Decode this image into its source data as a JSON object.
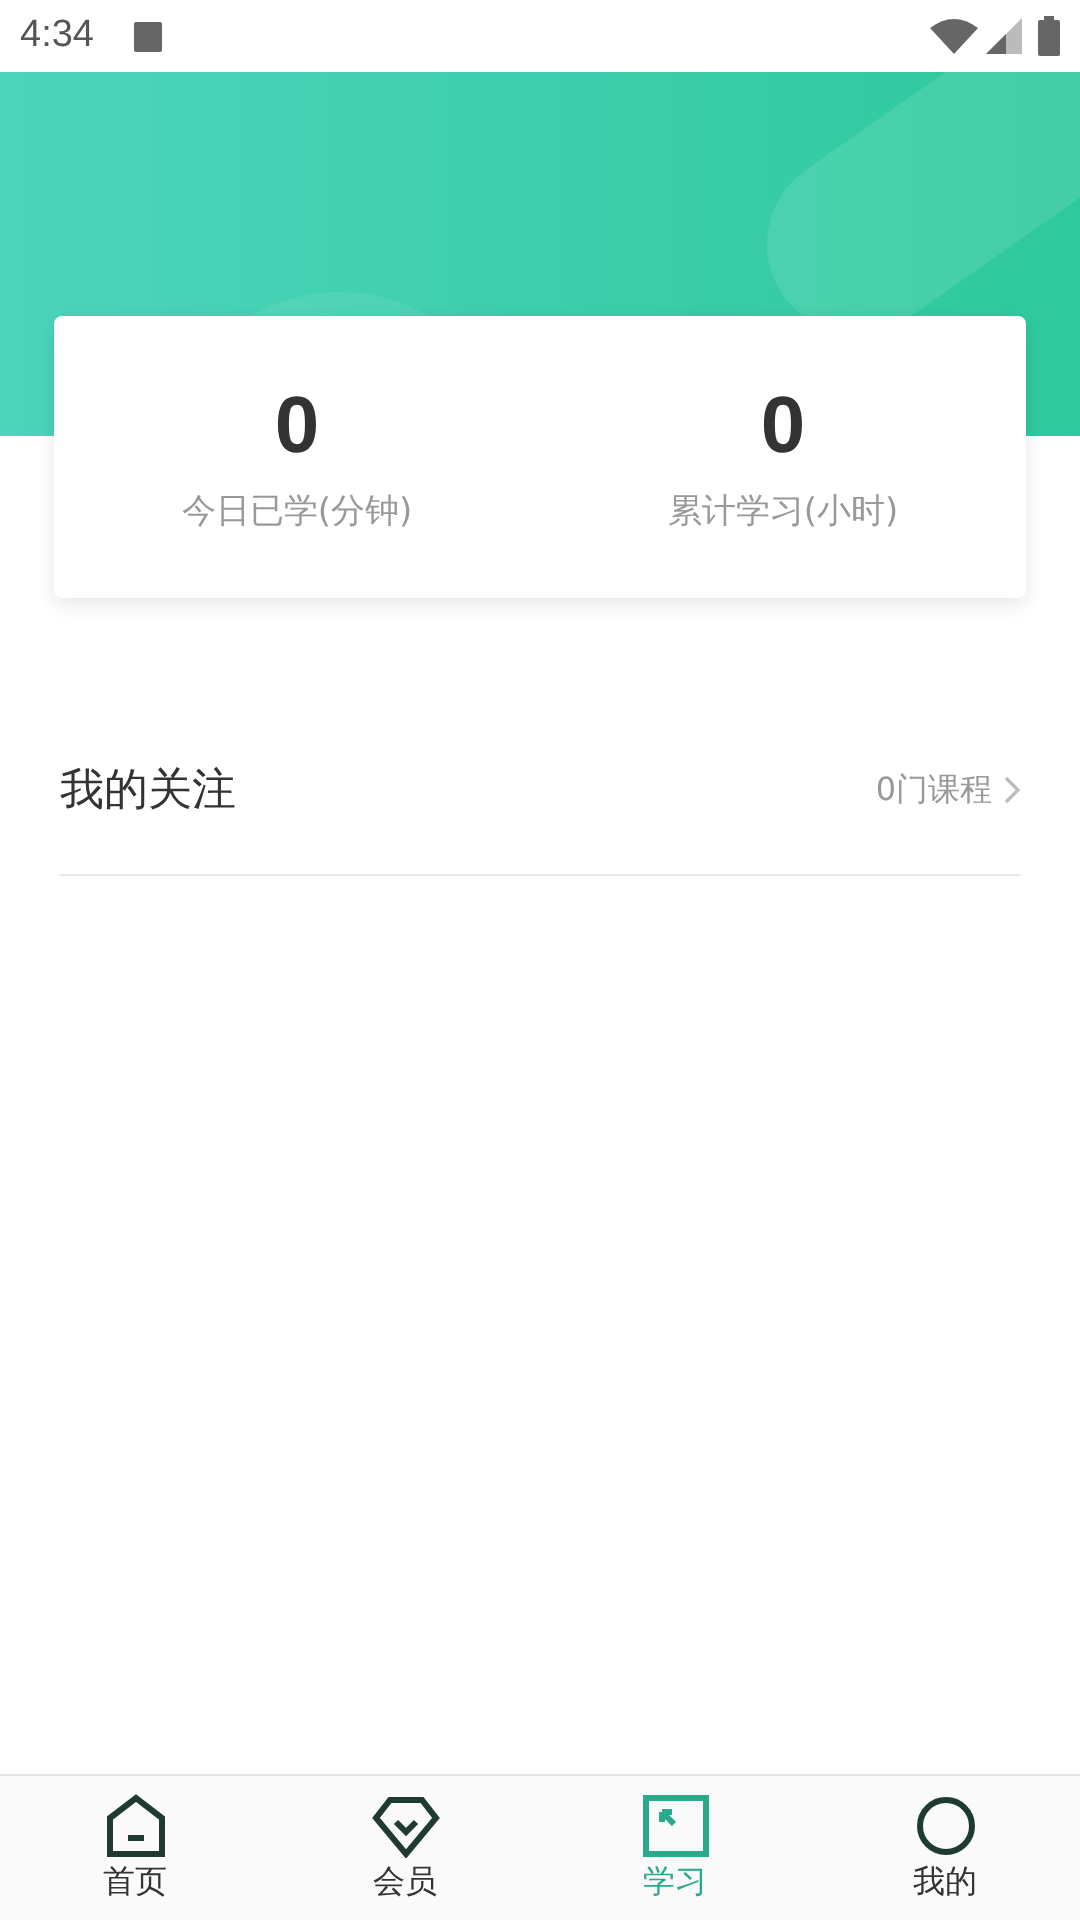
{
  "status_bar": {
    "time": "4:34"
  },
  "stats": [
    {
      "value": "0",
      "label": "今日已学(分钟)"
    },
    {
      "value": "0",
      "label": "累计学习(小时)"
    }
  ],
  "follow": {
    "title": "我的关注",
    "count": "0门课程"
  },
  "tabs": [
    {
      "label": "首页",
      "kind": "home",
      "selected": false
    },
    {
      "label": "会员",
      "kind": "member",
      "selected": false
    },
    {
      "label": "学习",
      "kind": "study",
      "selected": true
    },
    {
      "label": "我的",
      "kind": "me",
      "selected": false
    }
  ]
}
